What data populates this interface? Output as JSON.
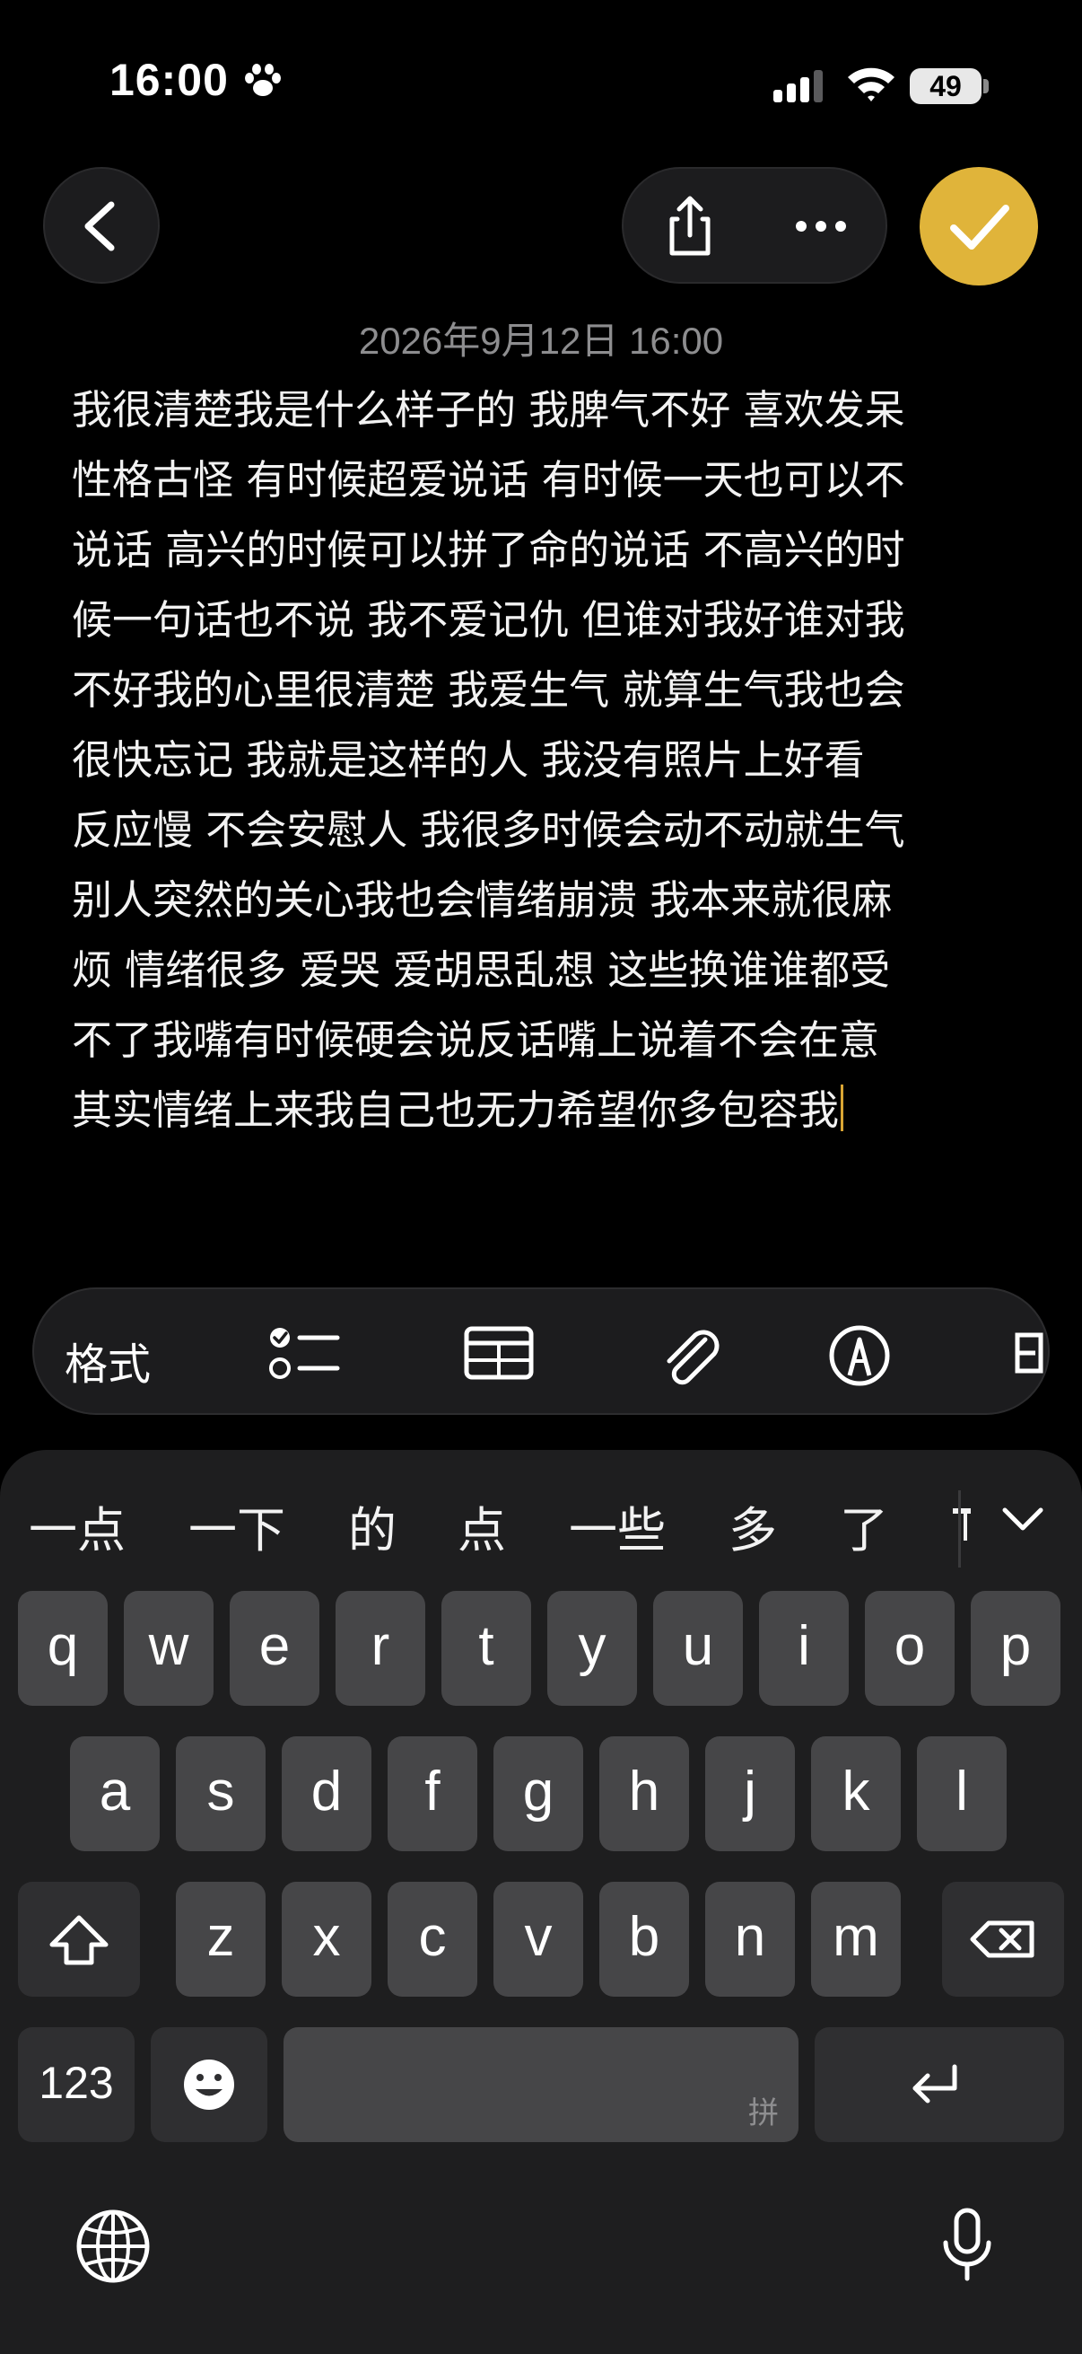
{
  "status_bar": {
    "time": "16:00",
    "battery": "49"
  },
  "note": {
    "date": "2026年9月12日 16:00",
    "lines": [
      "我很清楚我是什么样子的 我脾气不好 喜欢发呆",
      "性格古怪 有时候超爱说话 有时候一天也可以不",
      "说话 高兴的时候可以拼了命的说话 不高兴的时",
      "候一句话也不说 我不爱记仇 但谁对我好谁对我",
      "不好我的心里很清楚 我爱生气 就算生气我也会",
      "很快忘记 我就是这样的人 我没有照片上好看",
      "反应慢 不会安慰人 我很多时候会动不动就生气",
      "别人突然的关心我也会情绪崩溃 我本来就很麻",
      "烦 情绪很多 爱哭 爱胡思乱想 这些换谁谁都受",
      "不了我嘴有时候硬会说反话嘴上说着不会在意",
      "其实情绪上来我自己也无力希望你多包容我"
    ]
  },
  "toolbar": {
    "format_label": "格式",
    "icons": [
      "checklist-icon",
      "table-icon",
      "paperclip-icon",
      "markup-pen-icon",
      "more-tools-icon"
    ]
  },
  "keyboard": {
    "candidates": [
      "一点",
      "一下",
      "的",
      "点",
      "一些",
      "多",
      "了"
    ],
    "row1": [
      "q",
      "w",
      "e",
      "r",
      "t",
      "y",
      "u",
      "i",
      "o",
      "p"
    ],
    "row2": [
      "a",
      "s",
      "d",
      "f",
      "g",
      "h",
      "j",
      "k",
      "l"
    ],
    "row3": [
      "z",
      "x",
      "c",
      "v",
      "b",
      "n",
      "m"
    ],
    "numbers_label": "123",
    "space_hint": "拼"
  },
  "colors": {
    "accent": "#E0B43A",
    "caret": "#D9A534",
    "key": "#464648",
    "key_dark": "#2F2F31"
  }
}
